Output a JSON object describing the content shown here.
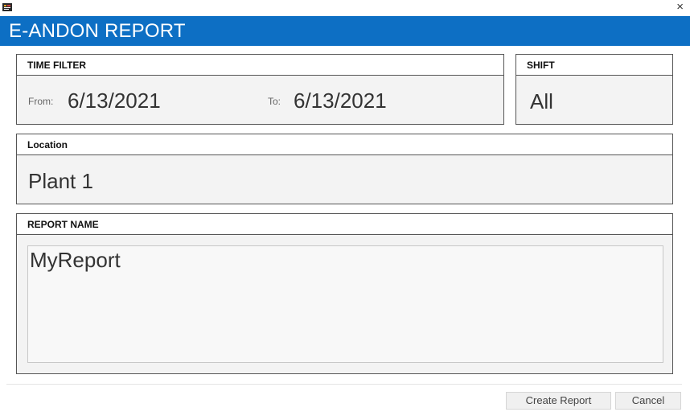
{
  "window": {
    "app_icon": "report-app-icon",
    "close_glyph": "×"
  },
  "banner": {
    "title": "E-ANDON REPORT"
  },
  "time_filter": {
    "header": "TIME FILTER",
    "from_label": "From:",
    "from_value": "6/13/2021",
    "to_label": "To:",
    "to_value": "6/13/2021"
  },
  "shift": {
    "header": "SHIFT",
    "value": "All"
  },
  "location": {
    "header": "Location",
    "value": "Plant 1"
  },
  "report_name": {
    "header": "REPORT NAME",
    "value": "MyReport"
  },
  "buttons": {
    "create": "Create Report",
    "cancel": "Cancel"
  },
  "colors": {
    "banner": "#0d6fc4",
    "panel_bg": "#f3f3f3",
    "border": "#555555"
  }
}
